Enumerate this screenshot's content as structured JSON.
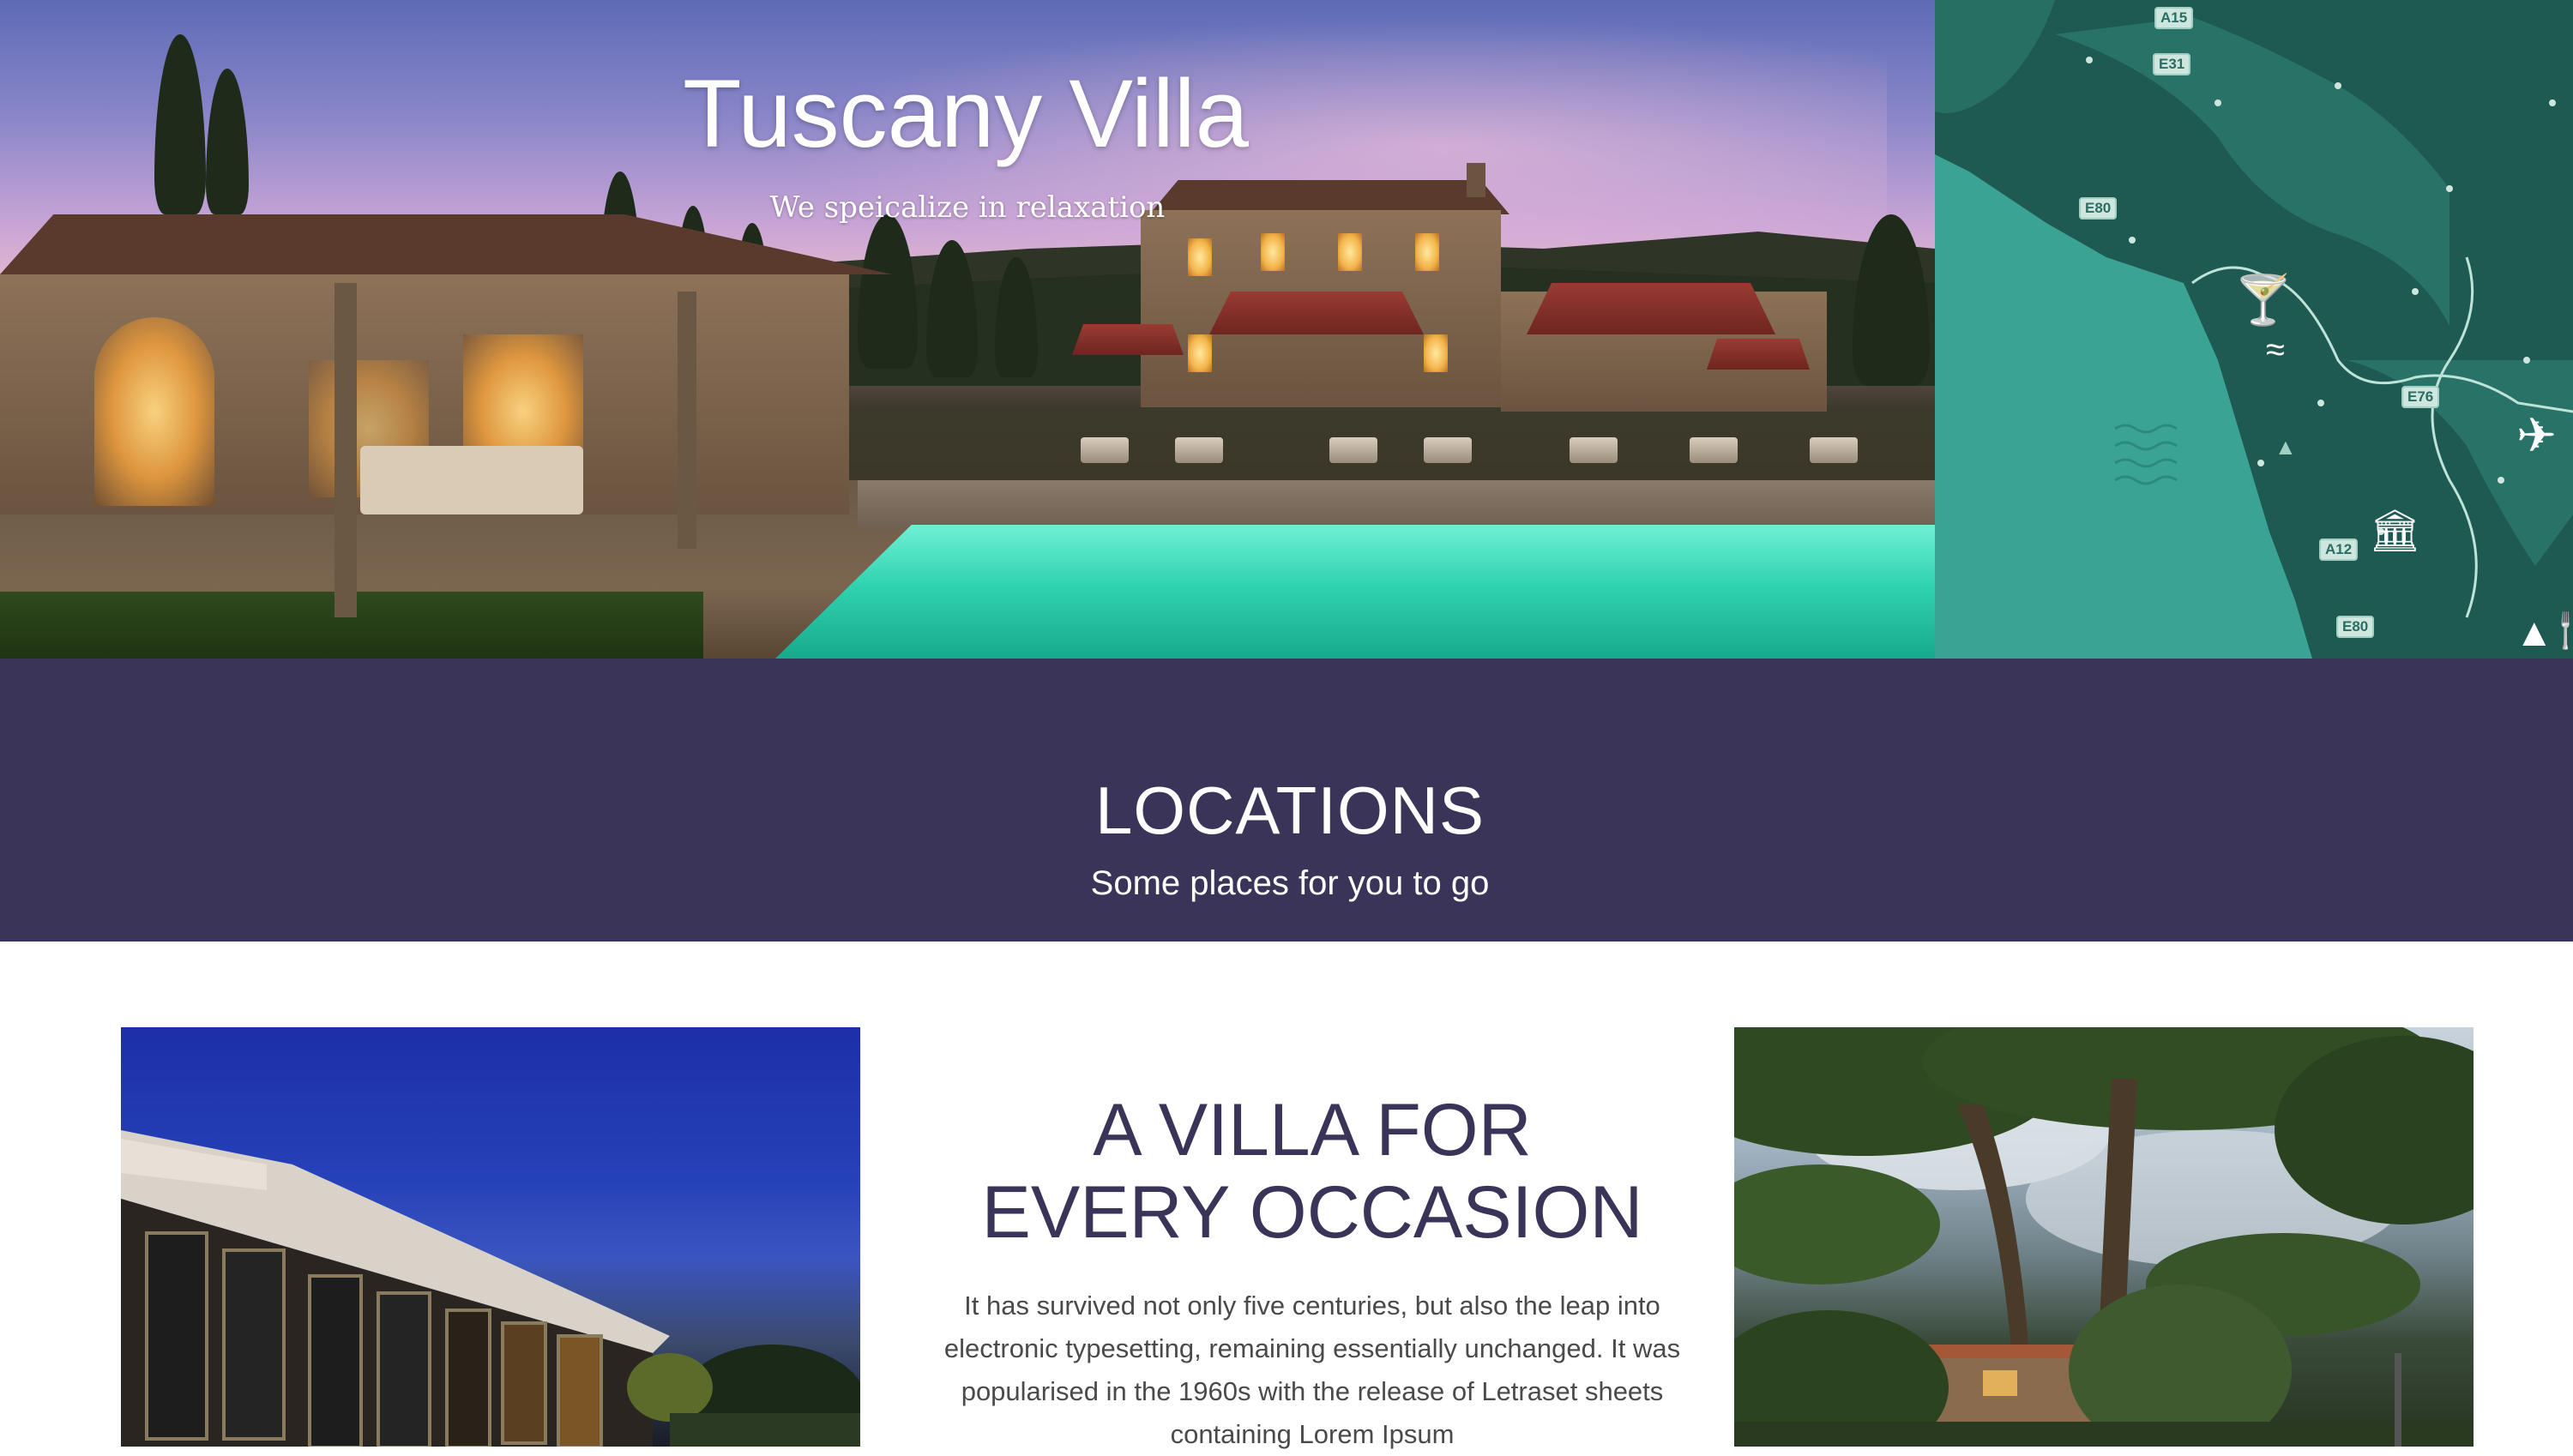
{
  "hero": {
    "title": "Tuscany Villa",
    "subtitle": "We speicalize in relaxation"
  },
  "map": {
    "road_labels": [
      "A15",
      "E31",
      "E80",
      "E76",
      "A12",
      "E80"
    ],
    "icons": [
      "cocktail-icon",
      "waves-icon",
      "tree-icon",
      "airplane-icon",
      "museum-icon",
      "fork-knife-icon"
    ]
  },
  "locations": {
    "title": "LOCATIONS",
    "subtitle": "Some places for you to go"
  },
  "feature": {
    "heading_line1": "A VILLA FOR",
    "heading_line2": "EVERY OCCASION",
    "body": "It has survived not only five centuries, but also the leap into electronic typesetting, remaining essentially unchanged. It was popularised in the 1960s with the release of Letraset sheets containing Lorem Ipsum"
  },
  "colors": {
    "band": "#3a3458",
    "map_water": "#3aa393",
    "map_land": "#1f5a52",
    "heading": "#3a3458"
  }
}
